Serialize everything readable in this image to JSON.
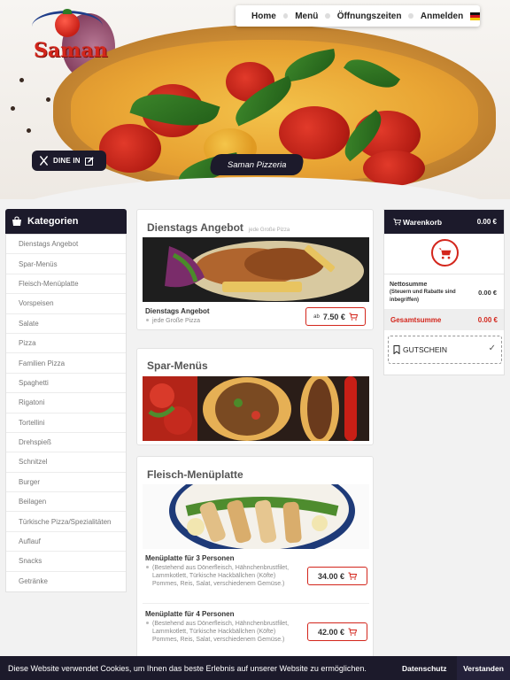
{
  "brand": {
    "logo_text": "Saman",
    "tagline": "Saman Pizzeria"
  },
  "colors": {
    "dark": "#1c1a2b",
    "accent": "#d3261c"
  },
  "nav": {
    "items": [
      "Home",
      "Menü",
      "Öffnungszeiten",
      "Anmelden"
    ],
    "language_icon": "german-flag-icon"
  },
  "hero": {
    "dine_label": "DINE IN",
    "dine_icon": "utensils-icon"
  },
  "categories": {
    "title": "Kategorien",
    "items": [
      "Dienstags Angebot",
      "Spar-Menüs",
      "Fleisch-Menüplatte",
      "Vorspeisen",
      "Salate",
      "Pizza",
      "Familien Pizza",
      "Spaghetti",
      "Rigatoni",
      "Tortellini",
      "Drehspieß",
      "Schnitzel",
      "Burger",
      "Beilagen",
      "Türkische Pizza/Spezialitäten",
      "Auflauf",
      "Snacks",
      "Getränke"
    ]
  },
  "menu": {
    "sections": [
      {
        "title": "Dienstags Angebot",
        "subtitle": "jede Große Pizza",
        "items": [
          {
            "name": "Dienstags Angebot",
            "desc": "jede Große Pizza",
            "price_prefix": "ab",
            "price": "7.50 €"
          }
        ]
      },
      {
        "title": "Spar-Menüs"
      },
      {
        "title": "Fleisch-Menüplatte",
        "items": [
          {
            "name": "Menüplatte für 3 Personen",
            "desc": "(Bestehend aus Dönerfleisch, Hähnchenbrustfilet, Lammkotlett, Türkische Hackbällchen (Köfte) Pommes, Reis, Salat, verschiedenem Gemüse.)",
            "price": "34.00 €"
          },
          {
            "name": "Menüplatte für 4 Personen",
            "desc": "(Bestehend aus Dönerfleisch, Hähnchenbrustfilet, Lammkotlett, Türkische Hackbällchen (Köfte) Pommes, Reis, Salat, verschiedenem Gemüse.)",
            "price": "42.00 €"
          }
        ]
      }
    ]
  },
  "cart": {
    "title": "Warenkorb",
    "total_header": "0.00 €",
    "net_label": "Nettosumme",
    "net_sub": "(Steuern und Rabatte sind inbegriffen)",
    "net_value": "0.00 €",
    "gross_label": "Gesamtsumme",
    "gross_value": "0.00 €",
    "voucher_label": "GUTSCHEIN"
  },
  "cookie": {
    "message": "Diese Website verwendet Cookies, um Ihnen das beste Erlebnis auf unserer Website zu ermöglichen.",
    "privacy": "Datenschutz",
    "accept": "Verstanden"
  }
}
